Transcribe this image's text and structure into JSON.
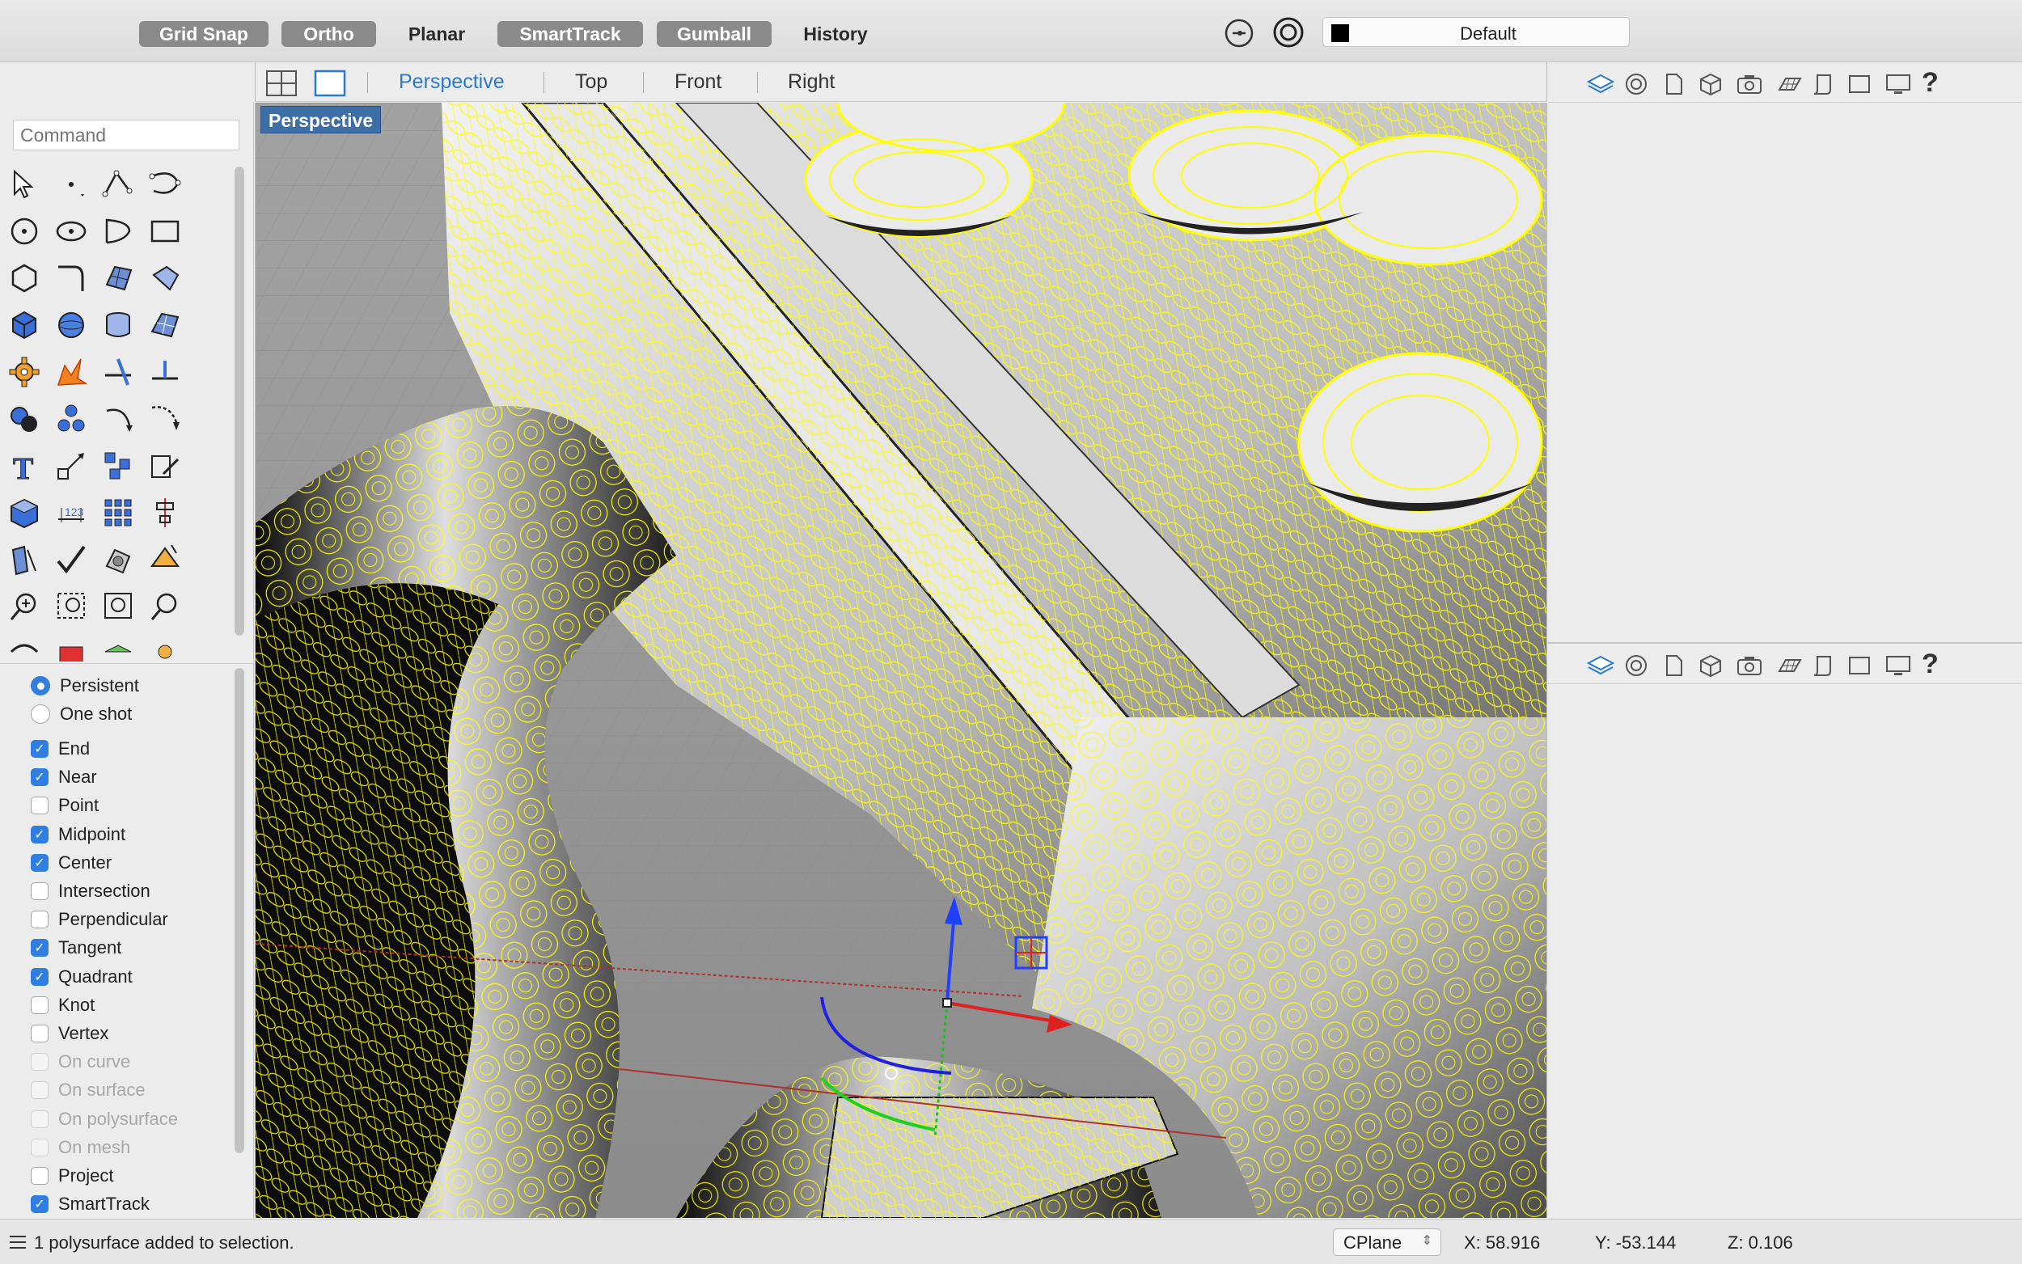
{
  "toolbar": {
    "grid_snap": "Grid Snap",
    "ortho": "Ortho",
    "planar": "Planar",
    "smarttrack": "SmartTrack",
    "gumball": "Gumball",
    "history": "History",
    "active_states": {
      "grid_snap": true,
      "ortho": true,
      "planar": false,
      "smarttrack": true,
      "gumball": true,
      "history": false
    },
    "icons": [
      "filter-icon",
      "target-icon"
    ],
    "layer": {
      "name": "Default",
      "color": "#000000"
    }
  },
  "viewport_tabs": {
    "tabs": [
      "Perspective",
      "Top",
      "Front",
      "Right"
    ],
    "active": "Perspective"
  },
  "command": {
    "placeholder": "Command"
  },
  "viewport": {
    "label": "Perspective",
    "wire_color": "#ffff00"
  },
  "osnap": {
    "mode": [
      {
        "label": "Persistent",
        "selected": true
      },
      {
        "label": "One shot",
        "selected": false
      }
    ],
    "items": [
      {
        "label": "End",
        "checked": true,
        "enabled": true
      },
      {
        "label": "Near",
        "checked": true,
        "enabled": true
      },
      {
        "label": "Point",
        "checked": false,
        "enabled": true
      },
      {
        "label": "Midpoint",
        "checked": true,
        "enabled": true
      },
      {
        "label": "Center",
        "checked": true,
        "enabled": true
      },
      {
        "label": "Intersection",
        "checked": false,
        "enabled": true
      },
      {
        "label": "Perpendicular",
        "checked": false,
        "enabled": true
      },
      {
        "label": "Tangent",
        "checked": true,
        "enabled": true
      },
      {
        "label": "Quadrant",
        "checked": true,
        "enabled": true
      },
      {
        "label": "Knot",
        "checked": false,
        "enabled": true
      },
      {
        "label": "Vertex",
        "checked": false,
        "enabled": true
      },
      {
        "label": "On curve",
        "checked": false,
        "enabled": false
      },
      {
        "label": "On surface",
        "checked": false,
        "enabled": false
      },
      {
        "label": "On polysurface",
        "checked": false,
        "enabled": false
      },
      {
        "label": "On mesh",
        "checked": false,
        "enabled": false
      },
      {
        "label": "Project",
        "checked": false,
        "enabled": true
      },
      {
        "label": "SmartTrack",
        "checked": true,
        "enabled": true
      }
    ]
  },
  "right_panel_icons": [
    "layers-icon",
    "material-icon",
    "document-icon",
    "object-icon",
    "camera-icon",
    "grid-icon",
    "notes-icon",
    "viewport-icon",
    "display-icon",
    "help-icon"
  ],
  "status": {
    "message": "1 polysurface added to selection.",
    "cplane": "CPlane",
    "x": "X: 58.916",
    "y": "Y: -53.144",
    "z": "Z: 0.106"
  }
}
